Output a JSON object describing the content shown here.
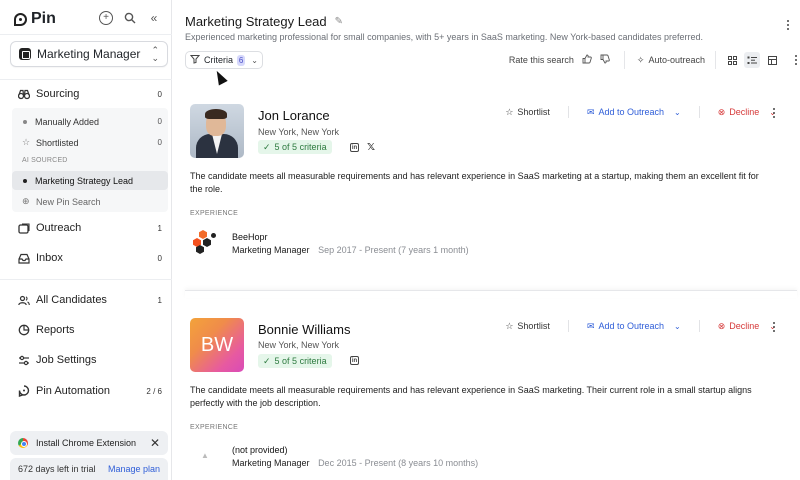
{
  "app": {
    "name": "Pin"
  },
  "sidebar": {
    "job_selector": "Marketing Manager",
    "nav": [
      {
        "label": "Sourcing",
        "count": "0",
        "icon": "binoculars-icon"
      },
      {
        "label": "Outreach",
        "count": "1",
        "icon": "outreach-icon"
      },
      {
        "label": "Inbox",
        "count": "0",
        "icon": "inbox-icon"
      },
      {
        "label": "All Candidates",
        "count": "1",
        "icon": "users-icon"
      },
      {
        "label": "Reports",
        "icon": "chart-pie-icon"
      },
      {
        "label": "Job Settings",
        "icon": "sliders-icon"
      },
      {
        "label": "Pin Automation",
        "count": "2 / 6",
        "icon": "pin-icon"
      }
    ],
    "sourcing_sub": {
      "manually_added": {
        "label": "Manually Added",
        "count": "0"
      },
      "shortlisted": {
        "label": "Shortlisted",
        "count": "0"
      },
      "heading": "AI SOURCED",
      "active_search": "Marketing Strategy Lead",
      "new_search": "New Pin Search"
    },
    "extension_banner": "Install Chrome Extension",
    "trial": {
      "text": "672 days left in trial",
      "link": "Manage plan"
    }
  },
  "header": {
    "title": "Marketing Strategy Lead",
    "description": "Experienced marketing professional for small companies, with 5+ years in SaaS marketing. New York-based candidates preferred.",
    "criteria_label": "Criteria",
    "criteria_count": "6",
    "rate_label": "Rate this search",
    "auto_outreach": "Auto-outreach"
  },
  "actions": {
    "shortlist": "Shortlist",
    "outreach": "Add to Outreach",
    "decline": "Decline"
  },
  "experience_label": "EXPERIENCE",
  "candidates": [
    {
      "name": "Jon Lorance",
      "location": "New York, New York",
      "criteria": "5 of 5 criteria",
      "summary": "The candidate meets all measurable requirements and has relevant experience in SaaS marketing at a startup, making them an excellent fit for the role.",
      "company": "BeeHopr",
      "role": "Marketing Manager",
      "dates": "Sep 2017 - Present (7 years 1 month)"
    },
    {
      "name": "Bonnie Williams",
      "initials": "BW",
      "location": "New York, New York",
      "criteria": "5 of 5 criteria",
      "summary": "The candidate meets all measurable requirements and has relevant experience in SaaS marketing. Their current role in a small startup aligns perfectly with the job description.",
      "company": "(not provided)",
      "role": "Marketing Manager",
      "dates": "Dec 2015 - Present (8 years 10 months)"
    }
  ],
  "colors": {
    "accent_blue": "#2f5ed8",
    "decline_red": "#d63a3a",
    "criteria_green": "#2d7a3f"
  }
}
